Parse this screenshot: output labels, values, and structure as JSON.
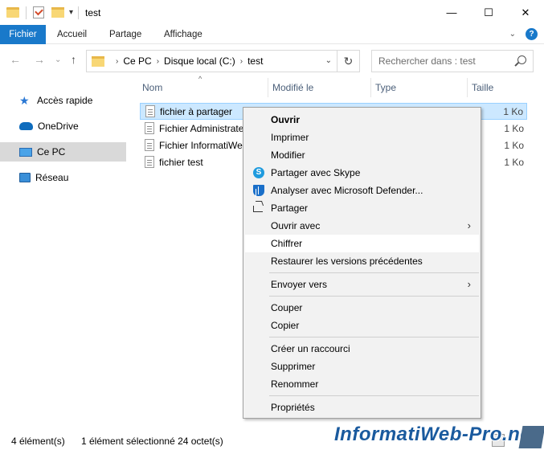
{
  "window": {
    "title": "test",
    "minimize": "—",
    "maximize": "☐",
    "close": "✕"
  },
  "ribbon": {
    "tabs": [
      "Fichier",
      "Accueil",
      "Partage",
      "Affichage"
    ],
    "collapse": "⌄",
    "help": "?"
  },
  "nav": {
    "back": "←",
    "forward": "→",
    "recent": "⌄",
    "up": "↑",
    "breadcrumb": [
      "Ce PC",
      "Disque local (C:)",
      "test"
    ],
    "crumb_sep": "›",
    "dropdown": "⌄",
    "refresh": "↻",
    "search_placeholder": "Rechercher dans : test"
  },
  "sidebar": {
    "items": [
      {
        "label": "Accès rapide",
        "icon": "star-icon"
      },
      {
        "label": "OneDrive",
        "icon": "cloud-icon"
      },
      {
        "label": "Ce PC",
        "icon": "computer-icon",
        "active": true
      },
      {
        "label": "Réseau",
        "icon": "network-icon"
      }
    ]
  },
  "columns": {
    "name": "Nom",
    "modified": "Modifié le",
    "type": "Type",
    "size": "Taille",
    "sort_indicator": "^"
  },
  "files": [
    {
      "name": "fichier à partager",
      "size": "1 Ko",
      "selected": true
    },
    {
      "name": "Fichier Administrateur",
      "size": "1 Ko"
    },
    {
      "name": "Fichier InformatiWeb",
      "size": "1 Ko"
    },
    {
      "name": "fichier test",
      "size": "1 Ko"
    }
  ],
  "context_menu": {
    "open": "Ouvrir",
    "print": "Imprimer",
    "edit": "Modifier",
    "skype": "Partager avec Skype",
    "skype_glyph": "S",
    "defender": "Analyser avec Microsoft Defender...",
    "share": "Partager",
    "open_with": "Ouvrir avec",
    "encrypt": "Chiffrer",
    "restore": "Restaurer les versions précédentes",
    "send_to": "Envoyer vers",
    "cut": "Couper",
    "copy": "Copier",
    "shortcut": "Créer un raccourci",
    "delete": "Supprimer",
    "rename": "Renommer",
    "properties": "Propriétés",
    "submenu_arrow": "›"
  },
  "status": {
    "count": "4 élément(s)",
    "selection": "1 élément sélectionné  24 octet(s)"
  },
  "watermark": "InformatiWeb-Pro.net"
}
